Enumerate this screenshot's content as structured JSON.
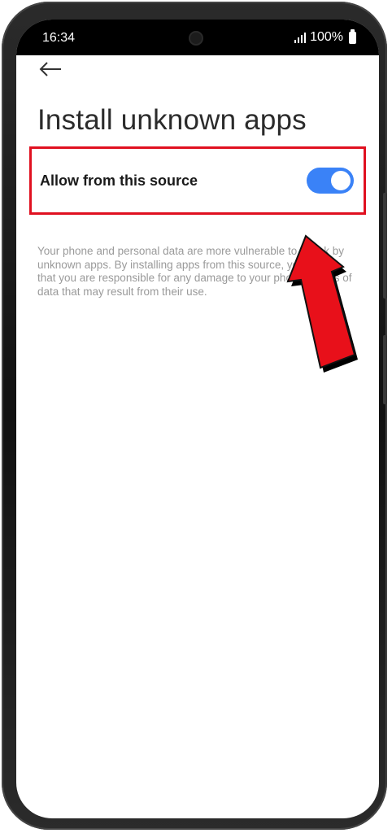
{
  "status_bar": {
    "time": "16:34",
    "battery": "100%",
    "icons": [
      "signal-icon",
      "battery-icon"
    ]
  },
  "header": {
    "back_icon": "arrow-left-icon",
    "title": "Install unknown apps"
  },
  "setting": {
    "label": "Allow from this source",
    "toggle_state": "on"
  },
  "description": "Your phone and personal data are more vulnerable to attack by unknown apps. By installing apps from this source, you agree that you are responsible for any damage to your phone or loss of data that may result from their use.",
  "colors": {
    "accent_toggle": "#3a82f7",
    "highlight_box": "#e01020",
    "arrow": "#e8101a"
  }
}
